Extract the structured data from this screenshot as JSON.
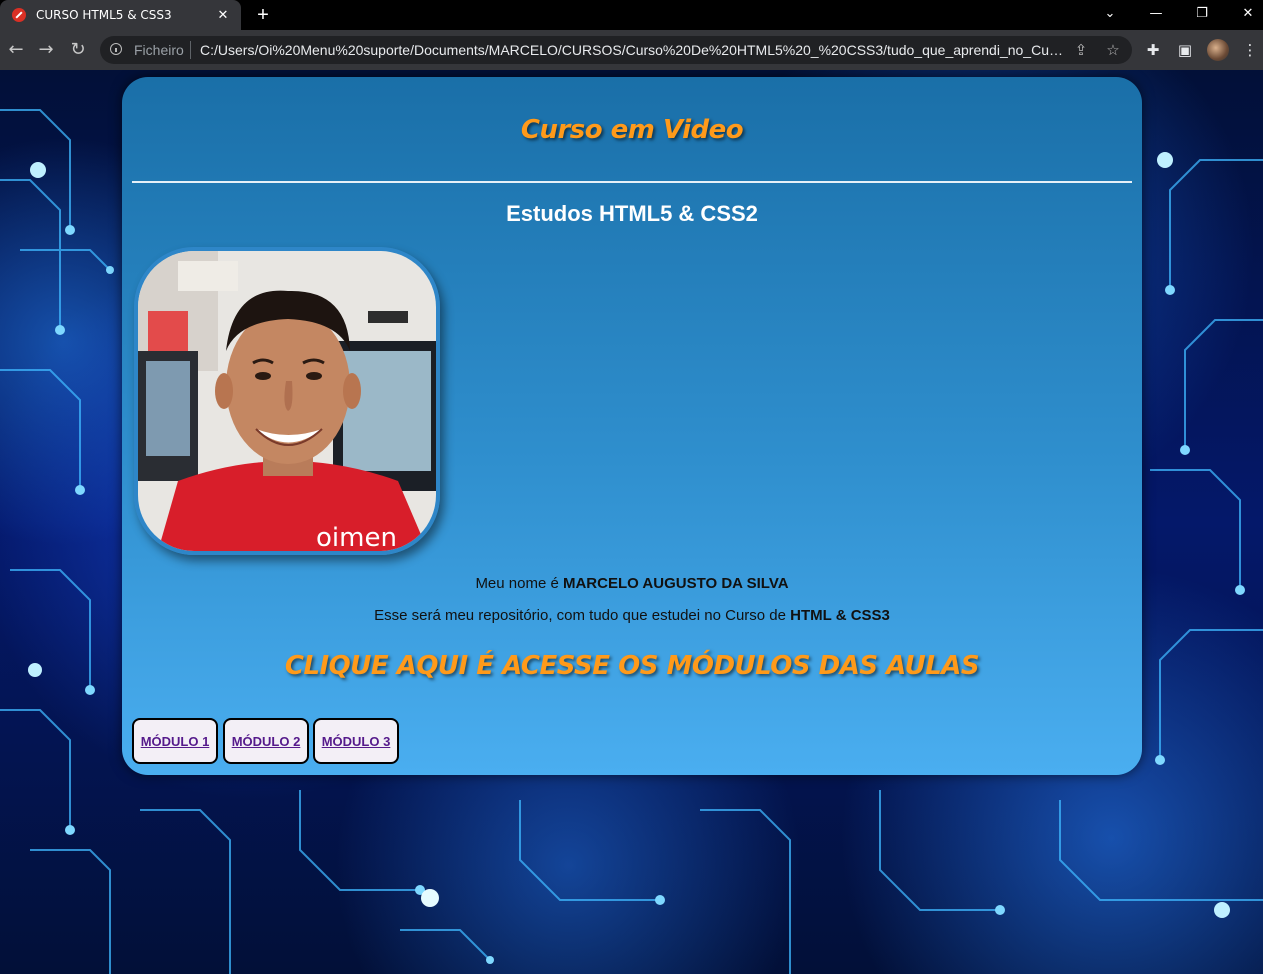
{
  "browser": {
    "tab_title": "CURSO HTML5 & CSS3",
    "tab_close": "✕",
    "new_tab": "+",
    "origin_label": "Ficheiro",
    "url": "C:/Users/Oi%20Menu%20suporte/Documents/MARCELO/CURSOS/Curso%20De%20HTML5%20_%20CSS3/tudo_que_aprendi_no_Curso/m...",
    "icons": [
      "back-icon",
      "forward-icon",
      "reload-icon",
      "info-icon",
      "share-icon",
      "star-icon",
      "extensions-icon",
      "sidepanel-icon",
      "profile-icon",
      "menu-icon"
    ]
  },
  "page": {
    "brand": "Curso em Video",
    "subtitle": "Estudos HTML5 & CSS2",
    "photo_caption": "oimen",
    "intro_prefix": "Meu nome é ",
    "intro_name": "MARCELO AUGUSTO DA SILVA",
    "repo_prefix": "Esse será meu repositório, com tudo que estudei no Curso de ",
    "repo_course": "HTML & CSS3",
    "cta": "CLIQUE AQUI É ACESSE OS MÓDULOS DAS AULAS",
    "modules": [
      {
        "label": "MÓDULO 1"
      },
      {
        "label": "MÓDULO 2"
      },
      {
        "label": "MÓDULO 3"
      }
    ]
  },
  "colors": {
    "accent_orange": "#ff9a1a",
    "card_top": "#1a6fa8",
    "card_bottom": "#4aaef0",
    "link_visited": "#551a8b"
  }
}
